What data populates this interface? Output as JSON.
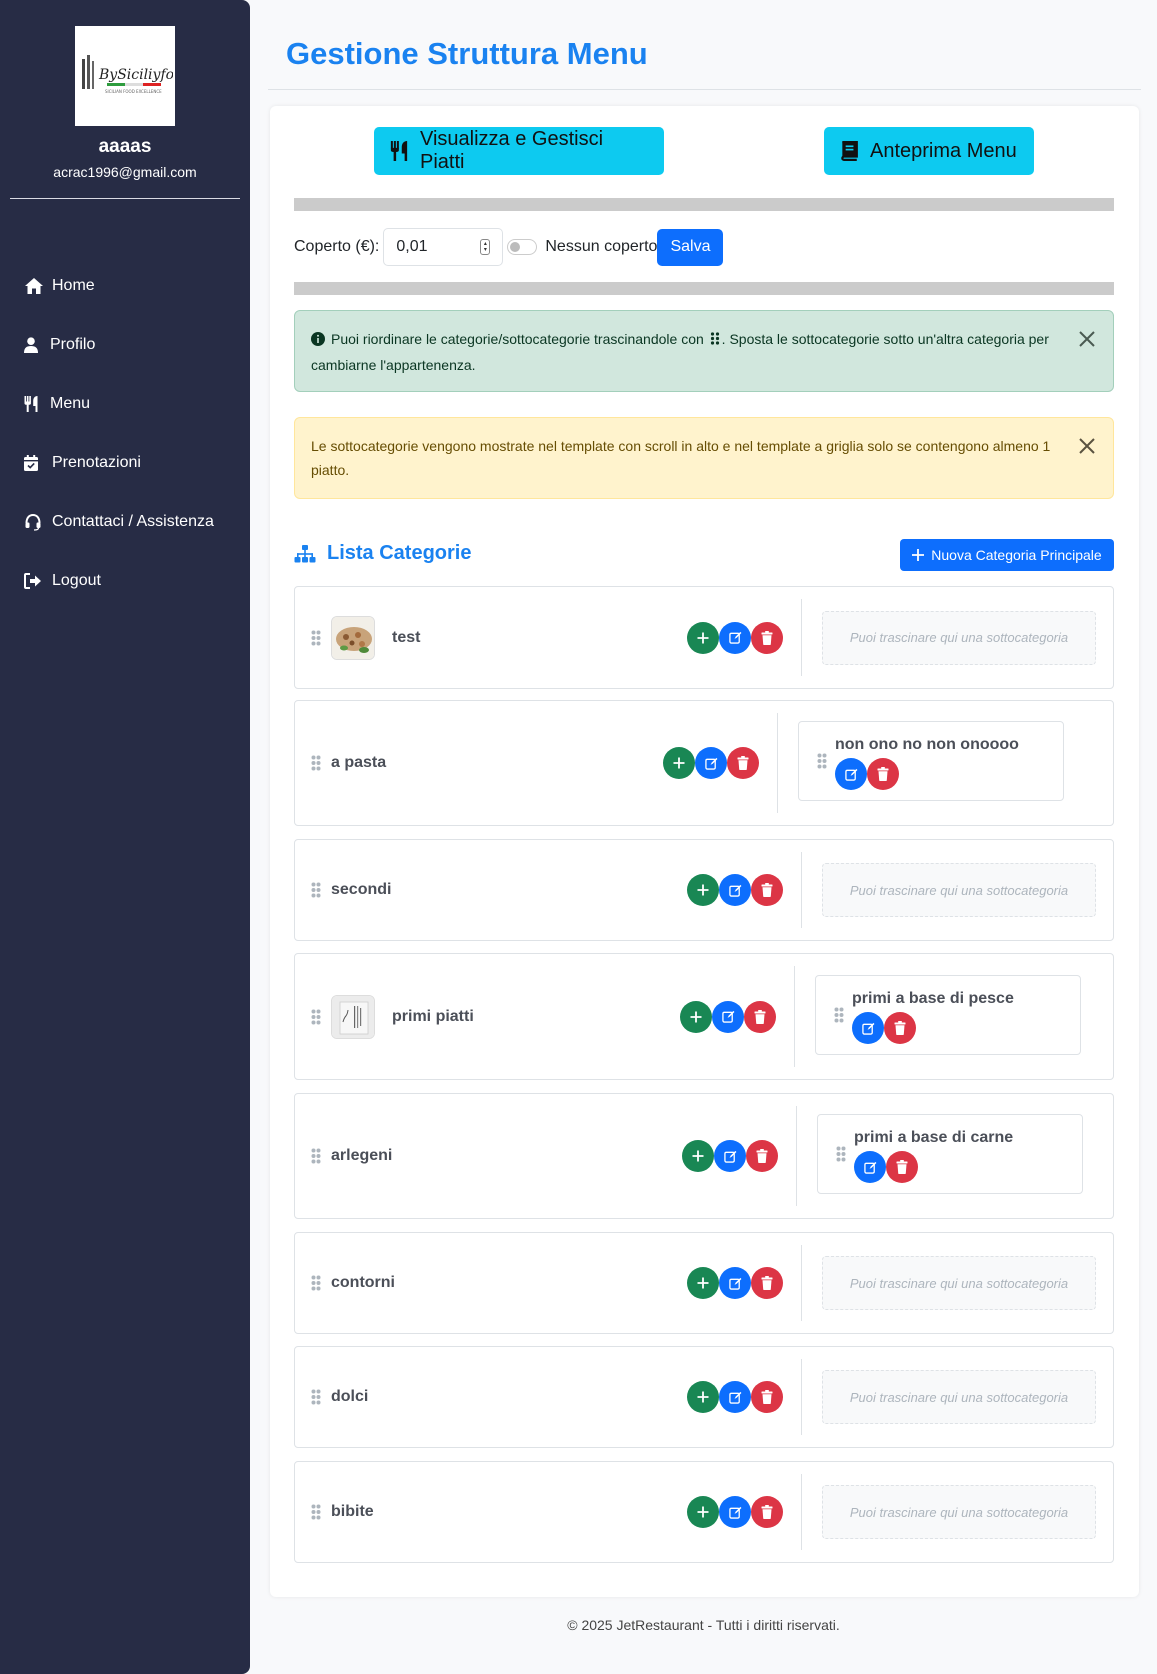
{
  "user": {
    "name": "aaaas",
    "email": "acrac1996@gmail.com"
  },
  "logo": {
    "brand": "BySiciliyfood",
    "tagline": "SICILIAN FOOD EXCELLENCE"
  },
  "nav": [
    {
      "label": "Home",
      "icon": "home-icon"
    },
    {
      "label": "Profilo",
      "icon": "user-icon"
    },
    {
      "label": "Menu",
      "icon": "utensils-icon"
    },
    {
      "label": "Prenotazioni",
      "icon": "calendar-icon"
    },
    {
      "label": "Contattaci / Assistenza",
      "icon": "headset-icon"
    },
    {
      "label": "Logout",
      "icon": "logout-icon"
    }
  ],
  "page": {
    "title": "Gestione Struttura Menu"
  },
  "toolbar": {
    "dishes_label": "Visualizza e Gestisci Piatti",
    "preview_label": "Anteprima Menu"
  },
  "coperto": {
    "label": "Coperto (€):",
    "value": "0,01",
    "toggle_label": "Nessun coperto",
    "toggle_on": false,
    "save_label": "Salva"
  },
  "alerts": {
    "info_before": "Puoi riordinare le categorie/sottocategorie trascinandole con",
    "info_after": ". Sposta le sottocategorie sotto un'altra categoria per cambiarne l'appartenenza.",
    "warning": "Le sottocategorie vengono mostrate nel template con scroll in alto e nel template a griglia solo se contengono almeno 1 piatto."
  },
  "list": {
    "title": "Lista Categorie",
    "new_label": "Nuova Categoria Principale",
    "drop_placeholder": "Puoi trascinare qui una sottocategoria"
  },
  "categories": [
    {
      "name": "test",
      "has_image": true,
      "subcategories": []
    },
    {
      "name": "a pasta",
      "has_image": false,
      "subcategories": [
        "non ono no non onoooo"
      ]
    },
    {
      "name": "secondi",
      "has_image": false,
      "subcategories": []
    },
    {
      "name": "primi piatti",
      "has_image": true,
      "subcategories": [
        "primi a base di pesce"
      ]
    },
    {
      "name": "arlegeni",
      "has_image": false,
      "subcategories": [
        "primi a base di carne"
      ]
    },
    {
      "name": "contorni",
      "has_image": false,
      "subcategories": []
    },
    {
      "name": "dolci",
      "has_image": false,
      "subcategories": []
    },
    {
      "name": "bibite",
      "has_image": false,
      "subcategories": []
    }
  ],
  "footer": {
    "text": "© 2025 JetRestaurant - Tutti i diritti riservati."
  },
  "colors": {
    "sidebar": "#272c45",
    "title": "#1a82f0",
    "info_button": "#0dcaf0",
    "primary": "#0d6efd",
    "success": "#198754",
    "danger": "#dc3545"
  }
}
